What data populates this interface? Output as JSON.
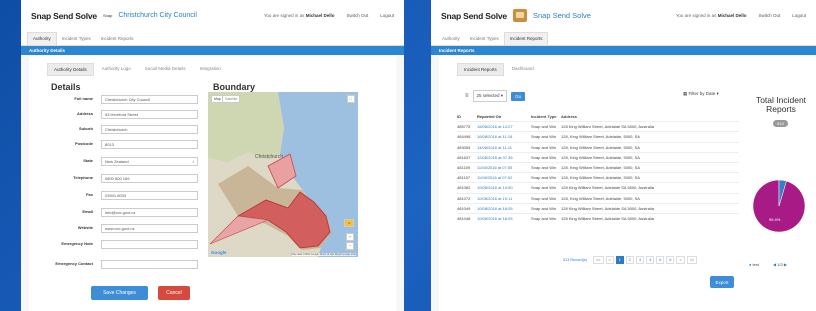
{
  "left_screen": {
    "brand": "Snap Send Solve",
    "small_logo_text": "Snap",
    "organisation": "Christchurch City Council",
    "signed_in_prefix": "You are signed in as",
    "user_name": "Michael Dello",
    "switch_out": "Switch Out",
    "logout": "Logout",
    "nav_tabs": [
      "Authority",
      "Incident Types",
      "Incident Reports"
    ],
    "section_bar": "Authority Details",
    "sub_tabs": [
      "Authority Details",
      "Authority Logo",
      "Social Media Details",
      "Integration"
    ],
    "details_heading": "Details",
    "boundary_heading": "Boundary",
    "fields": [
      {
        "label": "Full name",
        "value": "Christchurch City Council"
      },
      {
        "label": "Address",
        "value": "53 Hereford Street"
      },
      {
        "label": "Suburb",
        "value": "Christchurch"
      },
      {
        "label": "Postcode",
        "value": "8013"
      },
      {
        "label": "State",
        "value": "New Zealand"
      },
      {
        "label": "Telephone",
        "value": "0800 800 169"
      },
      {
        "label": "Fax",
        "value": "03941 8033"
      },
      {
        "label": "Email",
        "value": "info@ccc.govt.nz"
      },
      {
        "label": "Website",
        "value": "www.ccc.govt.nz"
      },
      {
        "label": "Emergency Note",
        "value": ""
      },
      {
        "label": "Emergency Contact",
        "value": ""
      }
    ],
    "map": {
      "type_map": "Map",
      "type_satellite": "Satellite",
      "city_label": "Christchurch",
      "footer": "Map data ©2016 Google   Terms of Use   Report a map error",
      "google": "Google"
    },
    "save_button": "Save Changes",
    "cancel_button": "Cancel"
  },
  "right_screen": {
    "brand": "Snap Send Solve",
    "organisation": "Snap Send Solve",
    "signed_in_prefix": "You are signed in as",
    "user_name": "Michael Dello",
    "switch_out": "Switch Out",
    "logout": "Logout",
    "nav_tabs": [
      "Authority",
      "Incident Types",
      "Incident Reports"
    ],
    "section_bar": "Incident Reports",
    "sub_tabs": [
      "Incident Reports",
      "Dashboard"
    ],
    "per_page": "25 selected",
    "go_button": "Go",
    "filter_label": "Filter by Date",
    "columns": [
      "ID",
      "Reported On",
      "Incident Type",
      "Address"
    ],
    "rows": [
      [
        "485775",
        "16/08/2016 at 14:27",
        "Snap and Win",
        "128 King William Street, Adelaide SA 5000, Australia"
      ],
      [
        "484498",
        "16/08/2016 at 11:18",
        "Snap and Win",
        "128, King William Street, Adelaide, 5000, SA"
      ],
      [
        "483055",
        "14/08/2016 at 11:11",
        "Snap and Win",
        "128, King William Street, Adelaide, 5000, SA"
      ],
      [
        "481637",
        "12/08/2016 at 07:35",
        "Snap and Win",
        "128, King William Street, Adelaide, 5000, SA"
      ],
      [
        "481159",
        "11/08/2016 at 07:55",
        "Snap and Win",
        "128, King William Street, Adelaide, 5000, SA"
      ],
      [
        "481157",
        "11/08/2016 at 07:52",
        "Snap and Win",
        "128, King William Street, Adelaide, 5000, SA"
      ],
      [
        "481082",
        "10/08/2016 at 19:50",
        "Snap and Win",
        "128 King William Street, Adelaide SA 5000, Australia"
      ],
      [
        "481072",
        "10/08/2016 at 19:11",
        "Snap and Win",
        "128, King William Street, Adelaide, 5000, SA"
      ],
      [
        "481049",
        "10/08/2016 at 18:05",
        "Snap and Win",
        "128 King William Street, Adelaide SA 5000, Australia"
      ],
      [
        "481048",
        "10/08/2016 at 18:05",
        "Snap and Win",
        "128 King William Street, Adelaide SA 5000, Australia"
      ]
    ],
    "records": "513 Record(s)",
    "pages": [
      "<<",
      "<",
      "1",
      "2",
      "3",
      "4",
      "5",
      "6",
      ">",
      ">>"
    ],
    "export_button": "Export",
    "side_title": "Total Incident Reports",
    "total_badge": "513",
    "pie_label": "95.4%",
    "legend_item": "test",
    "legend_nav": "1/3"
  },
  "colors": {
    "background": "#1a5cb0",
    "accent": "#2d86d0",
    "danger": "#d54a3d",
    "pie_main": "#a81b86",
    "pie_small": "#3a7cc8"
  },
  "chart_data": {
    "type": "pie",
    "title": "Total Incident Reports",
    "slices": [
      {
        "label": "95.4%",
        "value": 95.4
      },
      {
        "label": "",
        "value": 4.6
      }
    ]
  }
}
